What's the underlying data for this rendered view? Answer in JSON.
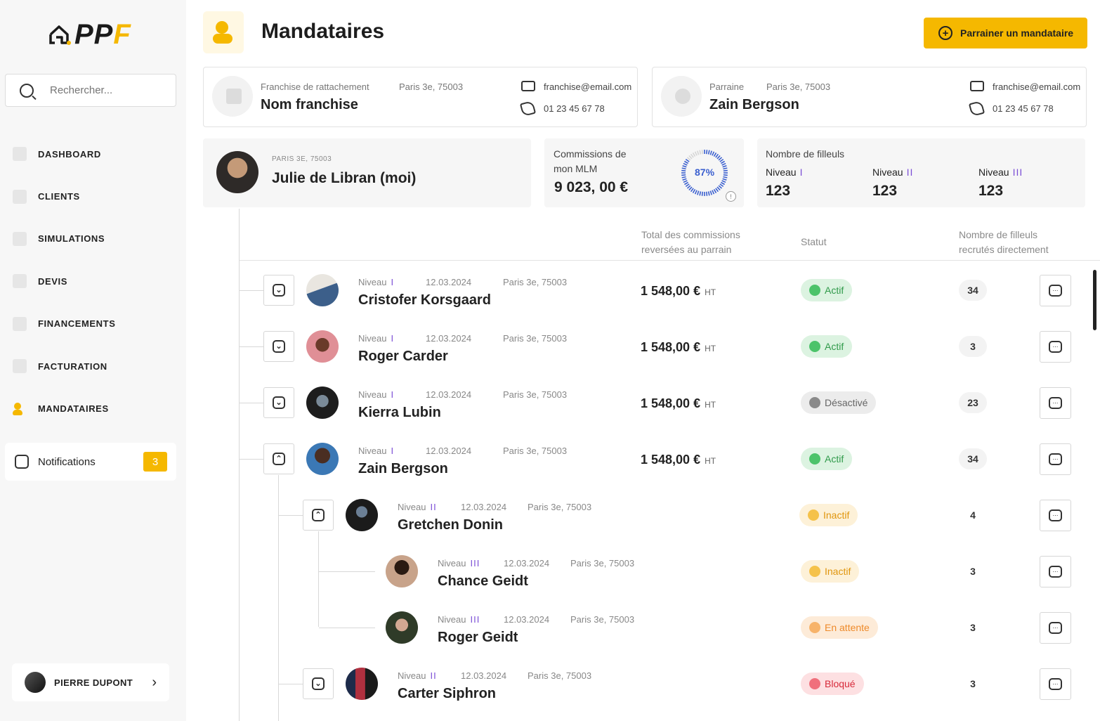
{
  "sidebar": {
    "logo_main": "PP",
    "logo_accent": "F",
    "search_placeholder": "Rechercher...",
    "nav": [
      {
        "label": "DASHBOARD",
        "icon": "dashboard-icon"
      },
      {
        "label": "CLIENTS",
        "icon": "clients-icon"
      },
      {
        "label": "SIMULATIONS",
        "icon": "simulations-icon"
      },
      {
        "label": "DEVIS",
        "icon": "devis-icon"
      },
      {
        "label": "FINANCEMENTS",
        "icon": "financements-icon"
      },
      {
        "label": "FACTURATION",
        "icon": "facturation-icon"
      },
      {
        "label": "MANDATAIRES",
        "icon": "mandataires-icon",
        "active": true
      }
    ],
    "notifications": {
      "label": "Notifications",
      "count": "3"
    },
    "user": {
      "name": "PIERRE DUPONT"
    }
  },
  "header": {
    "title": "Mandataires",
    "cta_label": "Parrainer un mandataire"
  },
  "franchise_card": {
    "label": "Franchise de rattachement",
    "location": "Paris 3e, 75003",
    "name": "Nom  franchise",
    "email": "franchise@email.com",
    "phone": "01 23 45 67 78"
  },
  "sponsor_card": {
    "label": "Parraine",
    "location": "Paris 3e, 75003",
    "name": "Zain Bergson",
    "email": "franchise@email.com",
    "phone": "01 23 45 67 78"
  },
  "me": {
    "location": "PARIS 3E, 75003",
    "name": "Julie de Libran  (moi)"
  },
  "commissions": {
    "label": "Commissions de mon MLM",
    "value": "9 023, 00 €",
    "percent": 87,
    "percent_label": "87%"
  },
  "filleuls": {
    "title": "Nombre de filleuls",
    "levels": [
      {
        "label": "Niveau",
        "bars": "I",
        "value": "123"
      },
      {
        "label": "Niveau",
        "bars": "II",
        "value": "123"
      },
      {
        "label": "Niveau",
        "bars": "III",
        "value": "123"
      }
    ]
  },
  "table": {
    "headers": {
      "commissions": "Total des commissions reversées au parrain",
      "status": "Statut",
      "filleuls": "Nombre de filleuls recrutés directement"
    },
    "rows": [
      {
        "level_label": "Niveau",
        "bars": "I",
        "date": "12.03.2024",
        "location": "Paris 3e, 75003",
        "name": "Cristofer Korsgaard",
        "amount": "1 548,00 €",
        "ht": "HT",
        "status": "Actif",
        "status_type": "actif",
        "count": "34",
        "toggle": "⌄"
      },
      {
        "level_label": "Niveau",
        "bars": "I",
        "date": "12.03.2024",
        "location": "Paris 3e, 75003",
        "name": "Roger Carder",
        "amount": "1 548,00 €",
        "ht": "HT",
        "status": "Actif",
        "status_type": "actif",
        "count": "3",
        "toggle": "⌄"
      },
      {
        "level_label": "Niveau",
        "bars": "I",
        "date": "12.03.2024",
        "location": "Paris 3e, 75003",
        "name": "Kierra Lubin",
        "amount": "1 548,00 €",
        "ht": "HT",
        "status": "Désactivé",
        "status_type": "desactive",
        "count": "23",
        "toggle": "⌄"
      },
      {
        "level_label": "Niveau",
        "bars": "I",
        "date": "12.03.2024",
        "location": "Paris 3e, 75003",
        "name": "Zain Bergson",
        "amount": "1 548,00 €",
        "ht": "HT",
        "status": "Actif",
        "status_type": "actif",
        "count": "34",
        "toggle": "⌃"
      },
      {
        "level_label": "Niveau",
        "bars": "II",
        "date": "12.03.2024",
        "location": "Paris 3e, 75003",
        "name": "Gretchen Donin",
        "status": "Inactif",
        "status_type": "inactif",
        "count": "4",
        "toggle": "⌃"
      },
      {
        "level_label": "Niveau",
        "bars": "III",
        "date": "12.03.2024",
        "location": "Paris 3e, 75003",
        "name": "Chance Geidt",
        "status": "Inactif",
        "status_type": "inactif",
        "count": "3"
      },
      {
        "level_label": "Niveau",
        "bars": "III",
        "date": "12.03.2024",
        "location": "Paris 3e, 75003",
        "name": "Roger Geidt",
        "status": "En attente",
        "status_type": "attente",
        "count": "3"
      },
      {
        "level_label": "Niveau",
        "bars": "II",
        "date": "12.03.2024",
        "location": "Paris 3e, 75003",
        "name": "Carter Siphron",
        "status": "Bloqué",
        "status_type": "bloque",
        "count": "3",
        "toggle": "⌄"
      }
    ]
  },
  "colors": {
    "accent": "#f5b800",
    "level_bars": "#7b4ed6",
    "gauge": "#3a5fcf"
  }
}
